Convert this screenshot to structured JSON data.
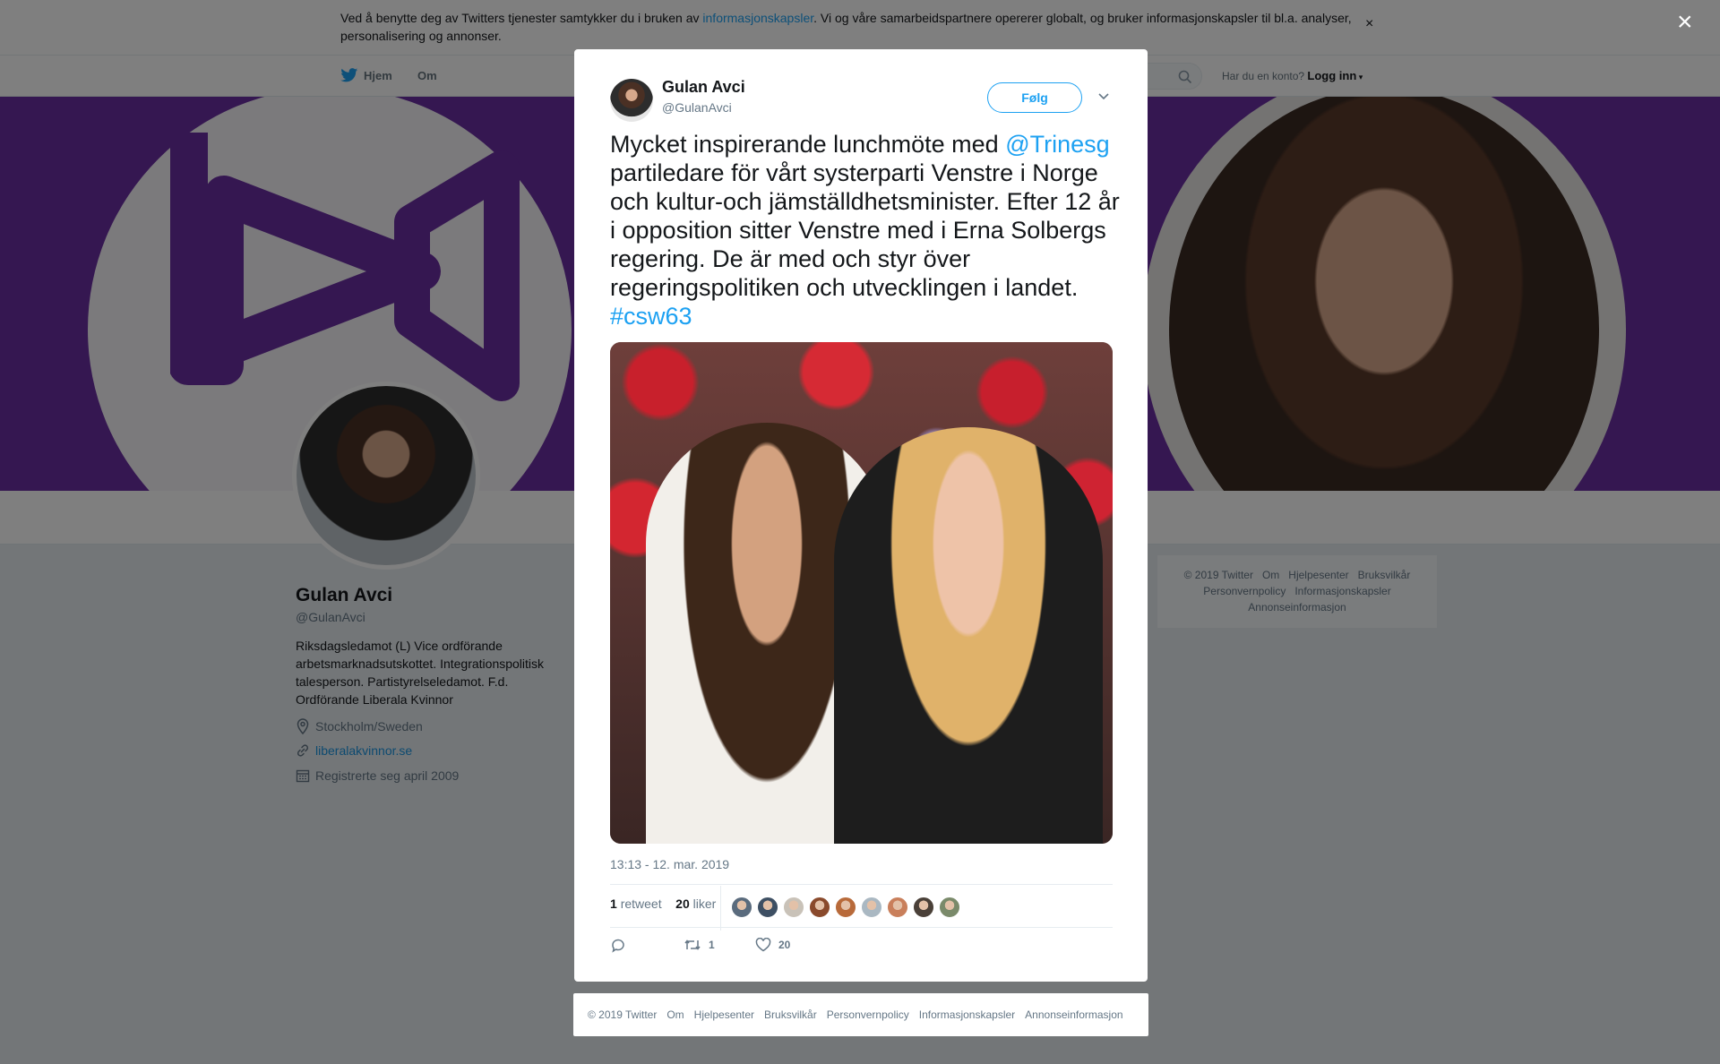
{
  "cookie": {
    "text_before": "Ved å benytte deg av Twitters tjenester samtykker du i bruken av ",
    "link": "informasjonskapsler",
    "text_after": ". Vi og våre samarbeidspartnere opererer globalt, og bruker informasjonskapsler til bl.a. analyser, personalisering og annonser.",
    "close": "×"
  },
  "nav": {
    "home": "Hjem",
    "about": "Om",
    "has_account": "Har du en konto?",
    "login": "Logg inn"
  },
  "profile": {
    "name": "Gulan Avci",
    "handle": "@GulanAvci",
    "bio": "Riksdagsledamot (L) Vice ordförande arbetsmarknadsutskottet. Integrationspolitisk talesperson. Partistyrelseledamot. F.d. Ordförande Liberala Kvinnor",
    "location": "Stockholm/Sweden",
    "website": "liberalakvinnor.se",
    "joined": "Registrerte seg april 2009"
  },
  "side_footer": {
    "items": [
      "© 2019 Twitter",
      "Om",
      "Hjelpesenter",
      "Bruksvilkår",
      "Personvernpolicy",
      "Informasjonskapsler",
      "Annonseinformasjon"
    ]
  },
  "overlay": {
    "close": "×"
  },
  "tweet": {
    "author_name": "Gulan Avci",
    "author_handle": "@GulanAvci",
    "follow": "Følg",
    "text_1": "Mycket inspirerande lunchmöte med ",
    "mention": "@Trinesg",
    "text_2": " partiledare för vårt systerparti Venstre i Norge och kultur-och jämställdhetsminister. Efter 12 år i opposition sitter Venstre med i Erna Solbergs regering. De är med och styr över regeringspolitiken och utvecklingen i landet. ",
    "hashtag": "#csw63",
    "timestamp": "13:13 - 12. mar. 2019",
    "retweet_count": "1",
    "retweet_label": "retweet",
    "like_count": "20",
    "like_label": "liker",
    "action_retweets": "1",
    "action_likes": "20"
  },
  "likers": [
    "#5a6b7d",
    "#3d4f63",
    "#c9c2b8",
    "#8a4a2c",
    "#b86a3a",
    "#aab8c2",
    "#c97f5b",
    "#4a4038",
    "#7a8a6a"
  ],
  "footer": {
    "items": [
      "© 2019 Twitter",
      "Om",
      "Hjelpesenter",
      "Bruksvilkår",
      "Personvernpolicy",
      "Informasjonskapsler",
      "Annonseinformasjon"
    ]
  },
  "colors": {
    "brand": "#1da1f2",
    "banner_purple": "#6b2ea3",
    "overlay": "rgba(0,0,0,0.5)"
  }
}
